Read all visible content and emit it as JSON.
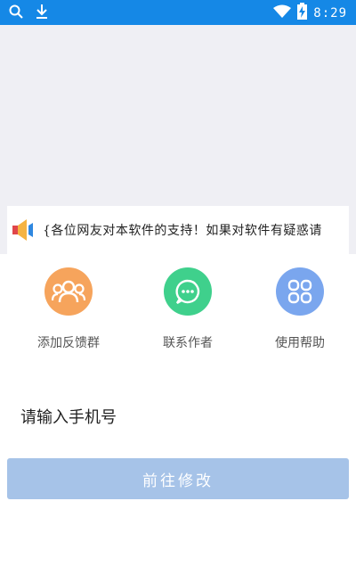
{
  "status_bar": {
    "time": "8:29",
    "icons": [
      "search-icon",
      "download-icon",
      "wifi-icon",
      "battery-charging-icon"
    ]
  },
  "notice": {
    "icon": "speaker-icon",
    "text": "{各位网友对本软件的支持！如果对软件有疑惑请"
  },
  "actions": [
    {
      "icon": "group-icon",
      "label": "添加反馈群",
      "color": "#f6a45c"
    },
    {
      "icon": "chat-icon",
      "label": "联系作者",
      "color": "#3fd08c"
    },
    {
      "icon": "apps-grid-icon",
      "label": "使用帮助",
      "color": "#7aa6ee"
    }
  ],
  "phone_field": {
    "placeholder": "请输入手机号"
  },
  "submit": {
    "label": "前往修改"
  },
  "colors": {
    "status_bar": "#1588e6",
    "background_gray": "#efeff4",
    "button": "#a6c3e8"
  }
}
